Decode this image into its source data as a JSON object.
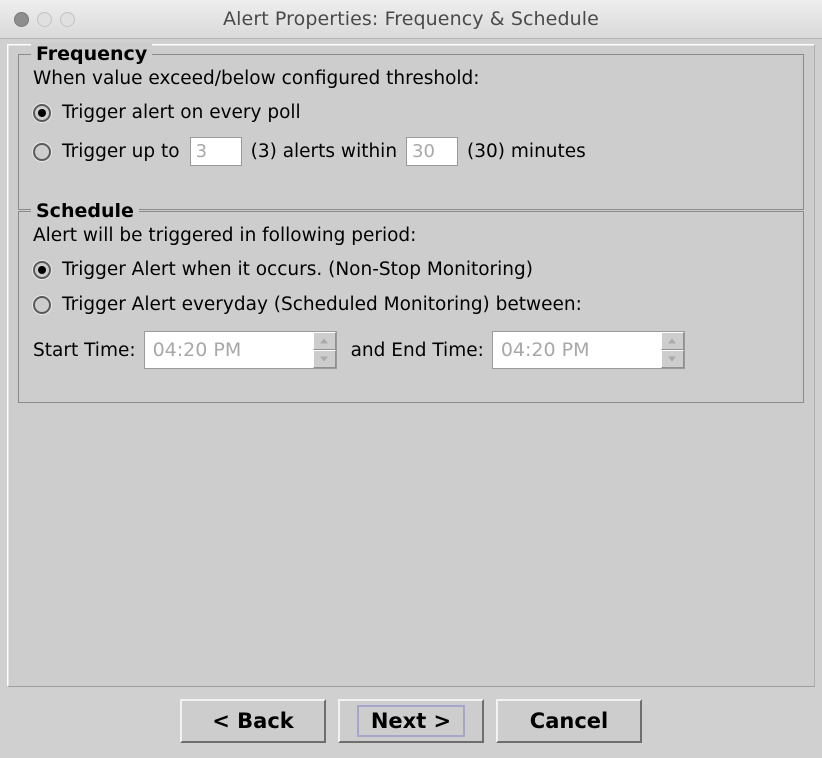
{
  "window": {
    "title": "Alert Properties: Frequency & Schedule",
    "controls": [
      {
        "name": "close",
        "icon": "close-button",
        "state": "inactive"
      },
      {
        "name": "minimize",
        "icon": "minimize-button",
        "state": "inactive"
      },
      {
        "name": "maximize",
        "icon": "maximize-button",
        "state": "inactive"
      }
    ]
  },
  "frequency": {
    "legend": "Frequency",
    "prompt": "When value exceed/below configured threshold:",
    "options": [
      {
        "label": "Trigger alert on every poll",
        "selected": true
      },
      {
        "label_before": "Trigger up to",
        "label_middle": "(3) alerts within",
        "label_after": "(30) minutes",
        "selected": false
      }
    ],
    "count_input": {
      "value": "3",
      "placeholder": "3",
      "disabled": true
    },
    "minutes_input": {
      "value": "30",
      "placeholder": "30",
      "disabled": true
    }
  },
  "schedule": {
    "legend": "Schedule",
    "prompt": "Alert will be triggered in following period:",
    "options": [
      {
        "label": "Trigger Alert when it occurs. (Non-Stop Monitoring)",
        "selected": true
      },
      {
        "label": "Trigger Alert everyday (Scheduled Monitoring) between:",
        "selected": false
      }
    ],
    "start_time_label": "Start Time:",
    "start_time_value": "04:20 PM",
    "end_time_label": "and End Time:",
    "end_time_value": "04:20 PM",
    "time_disabled": true
  },
  "buttons": {
    "back": "< Back",
    "next": "Next >",
    "cancel": "Cancel",
    "focused": "next",
    "focus_ring_color": "#a6a6cc"
  },
  "colors": {
    "window_background": "#d0d0d0",
    "panel_background": "#cdcdcd",
    "titlebar_background": "#e6e6e6",
    "title_text": "#4a4a4a",
    "body_text": "#000000",
    "disabled_text": "#a8a8a8",
    "group_border": "#8a8a8a",
    "field_background": "#ffffff"
  }
}
